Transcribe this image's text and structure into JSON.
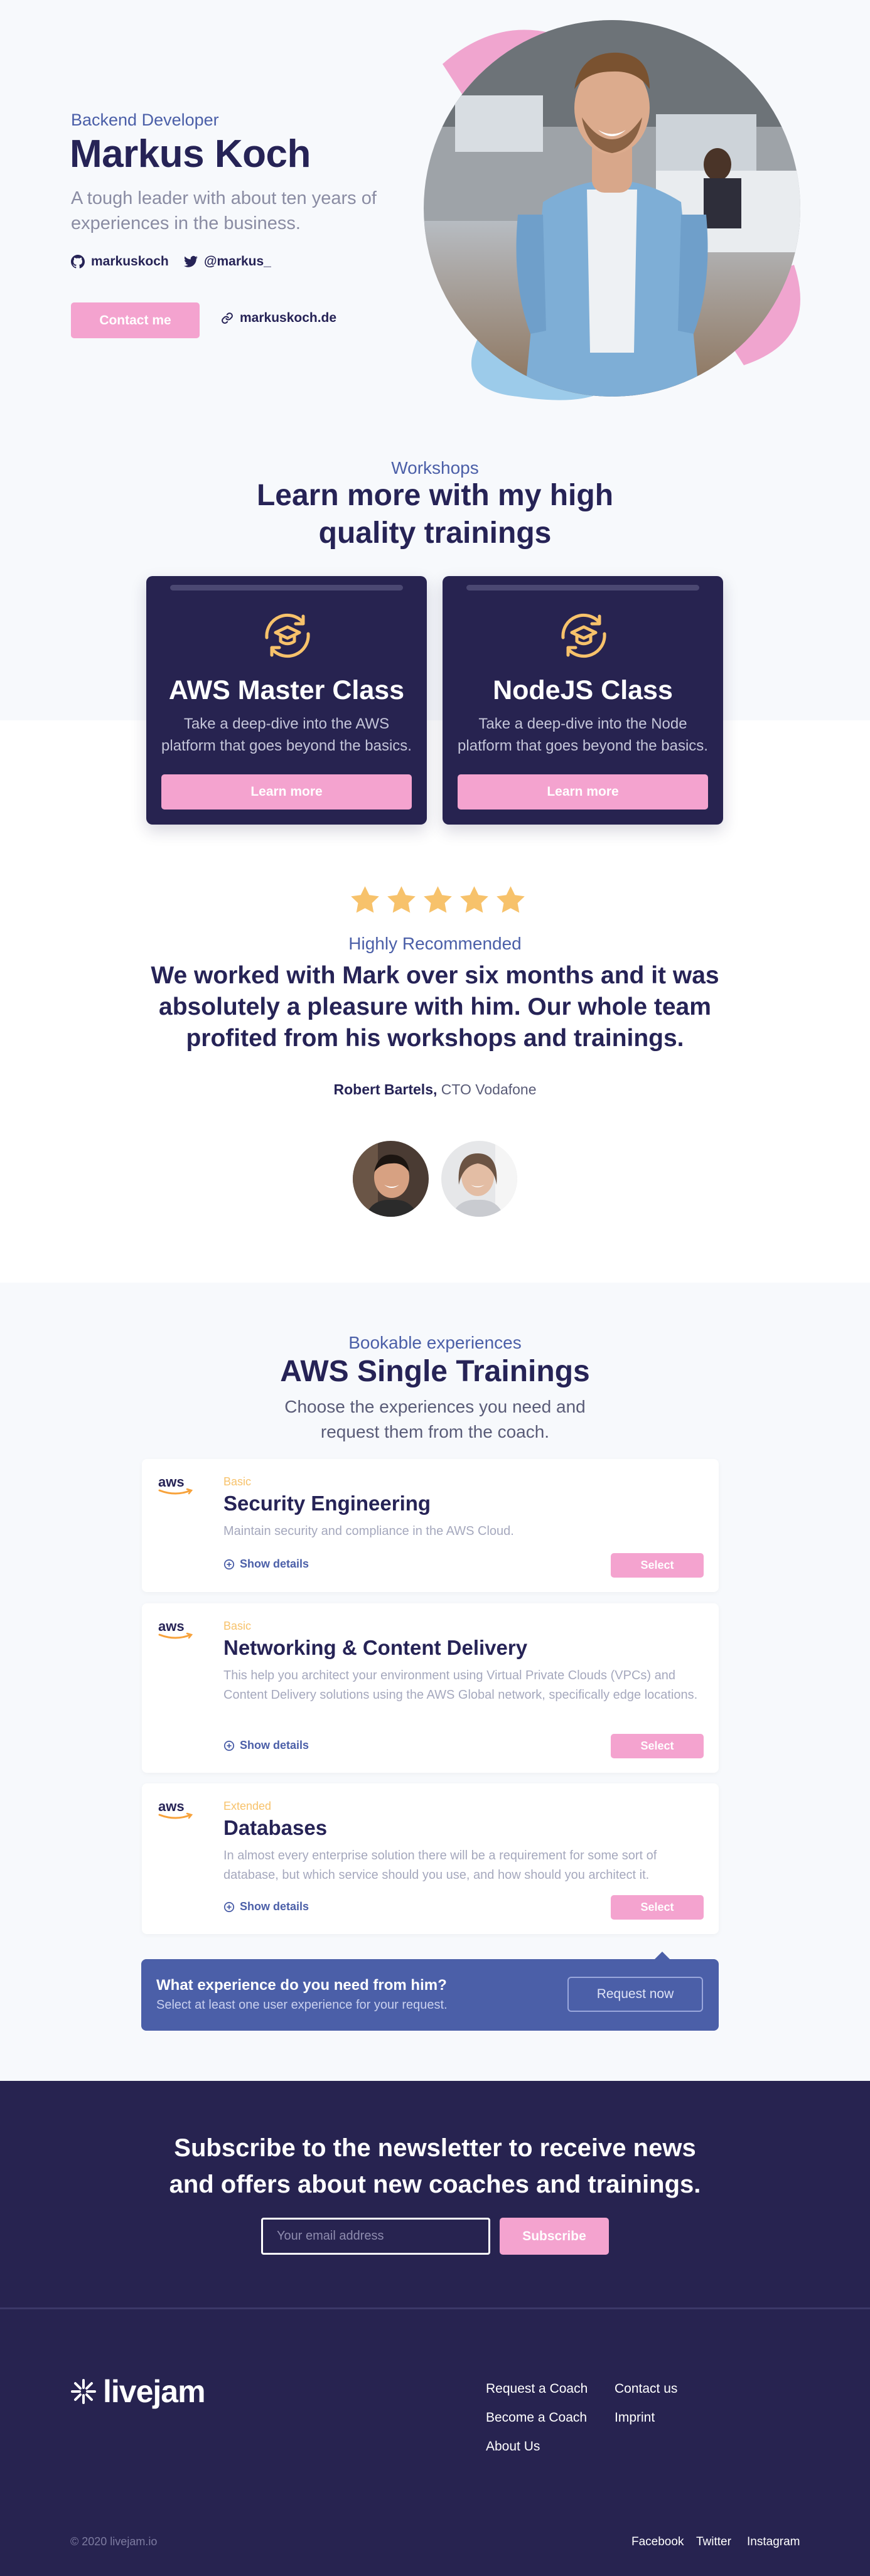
{
  "hero": {
    "role": "Backend Developer",
    "name": "Markus Koch",
    "tagline": "A tough leader with about ten years of experiences in the business.",
    "github": "markuskoch",
    "twitter": "@markus_",
    "contact_label": "Contact me",
    "website": "markuskoch.de"
  },
  "workshops": {
    "eyebrow": "Workshops",
    "title_line1": "Learn more with my high",
    "title_line2": "quality trainings",
    "cards": [
      {
        "title": "AWS Master Class",
        "desc": "Take a deep-dive into the AWS platform that goes beyond the basics.",
        "button": "Learn more"
      },
      {
        "title": "NodeJS Class",
        "desc": "Take a deep-dive into the Node platform that goes beyond the basics.",
        "button": "Learn more"
      }
    ]
  },
  "testimonial": {
    "rating": 5,
    "eyebrow": "Highly Recommended",
    "quote": "We worked with Mark over six months and it was absolutely a pleasure with him. Our whole team profited from his workshops and trainings.",
    "author_name": "Robert Bartels,",
    "author_role": " CTO Vodafone"
  },
  "trainings": {
    "eyebrow": "Bookable experiences",
    "title": "AWS Single Trainings",
    "subtitle": "Choose the experiences you need and request them from the coach.",
    "items": [
      {
        "level": "Basic",
        "title": "Security Engineering",
        "desc": "Maintain security and compliance in the AWS Cloud.",
        "details": "Show details",
        "select": "Select"
      },
      {
        "level": "Basic",
        "title": "Networking & Content Delivery",
        "desc": "This help you architect your environment using Virtual Private Clouds (VPCs) and Content Delivery solutions using the AWS Global network, specifically edge locations.",
        "details": "Show details",
        "select": "Select"
      },
      {
        "level": "Extended",
        "title": "Databases",
        "desc": "In almost every enterprise solution there will be a requirement for some sort of database, but which service should you use, and how should you architect it.",
        "details": "Show details",
        "select": "Select"
      }
    ],
    "logo_text": "aws"
  },
  "request": {
    "question": "What experience do you need from him?",
    "hint": "Select at least one user experience for your request.",
    "button": "Request now"
  },
  "newsletter": {
    "title_line1": "Subscribe to the newsletter to receive news",
    "title_line2": "and offers about new coaches and trainings.",
    "placeholder": "Your email address",
    "button": "Subscribe"
  },
  "footer": {
    "brand": "livejam",
    "links_col1": [
      "Request a Coach",
      "Become a Coach",
      "About Us"
    ],
    "links_col2": [
      "Contact us",
      "Imprint"
    ],
    "copyright": "© 2020 livejam.io",
    "social": [
      "Facebook",
      "Twitter",
      "Instagram"
    ]
  },
  "colors": {
    "navy": "#262356",
    "accent_blue": "#4b5fa8",
    "pink": "#f4a3cf",
    "star": "#f7c26b",
    "light_bg": "#f7f9fc"
  }
}
